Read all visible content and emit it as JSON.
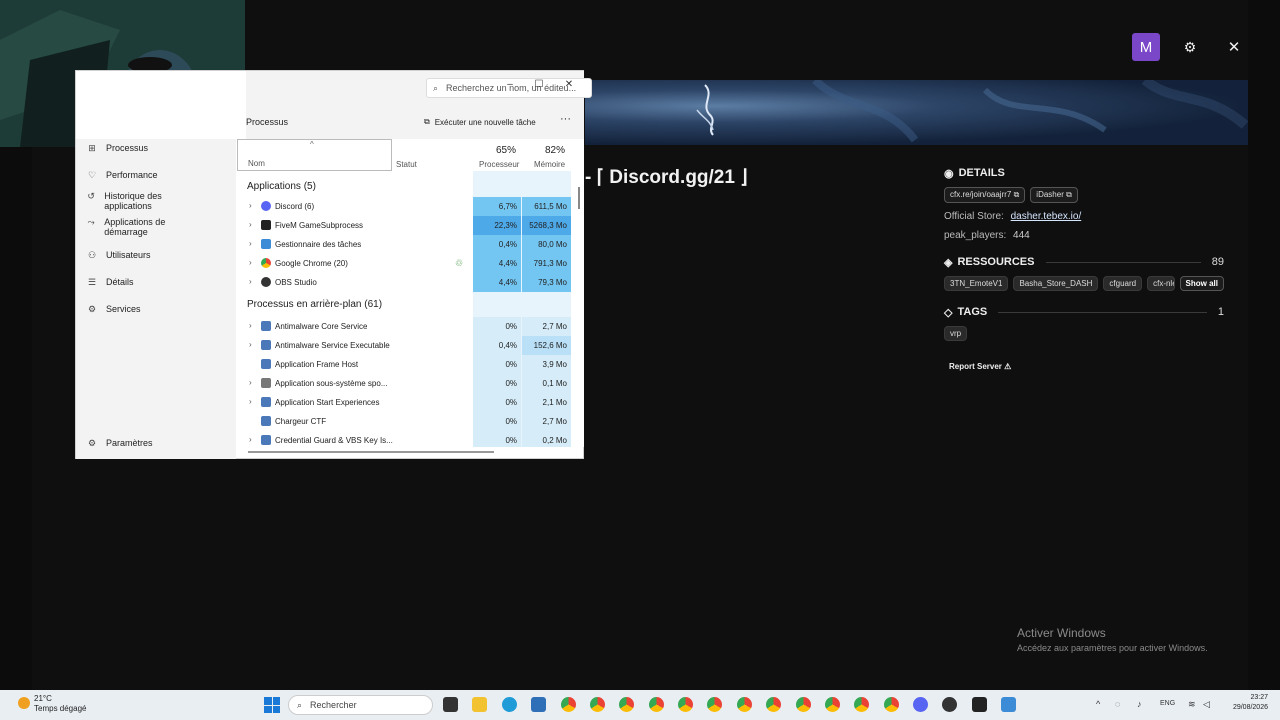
{
  "header": {
    "avatar_letter": "M",
    "settings_icon": "gear-icon",
    "close_icon": "close-icon"
  },
  "server": {
    "title_fragment": "- ⌈ Discord.gg/21 ⌋",
    "details": {
      "heading": "DETAILS",
      "links": [
        "cfx.re/join/oaajrr7 ⧉",
        "iDasher ⧉"
      ],
      "official_store_label": "Official Store:",
      "official_store_value": "dasher.tebex.io/",
      "peak_players_label": "peak_players:",
      "peak_players_value": "444"
    },
    "resources": {
      "heading": "RESSOURCES",
      "count": "89",
      "items": [
        "3TN_EmoteV1",
        "Basha_Store_DASH",
        "cfguard",
        "cfx-nle"
      ],
      "show_all": "Show all"
    },
    "tags": {
      "heading": "TAGS",
      "count": "1",
      "items": [
        "vrp"
      ]
    },
    "report": "Report Server ⚠"
  },
  "windows_activation": {
    "title": "Activer Windows",
    "subtitle": "Accédez aux paramètres pour activer Windows."
  },
  "task_manager": {
    "search_placeholder": "Recherchez un nom, un éditeu...",
    "window_controls": {
      "minimize": "–",
      "maximize": "☐",
      "close": "✕"
    },
    "page_title": "Processus",
    "run_task": "Exécuter une nouvelle tâche",
    "more": "···",
    "nav": {
      "processus": "Processus",
      "performance": "Performance",
      "historique": "Historique des applications",
      "demarrage": "Applications de démarrage",
      "utilisateurs": "Utilisateurs",
      "details": "Détails",
      "services": "Services",
      "parametres": "Paramètres"
    },
    "columns": {
      "nom": "Nom",
      "statut": "Statut",
      "processeur": "Processeur",
      "memoire": "Mémoire"
    },
    "totals": {
      "cpu": "65%",
      "mem": "82%"
    },
    "groups": {
      "apps": "Applications (5)",
      "background": "Processus en arrière-plan (61)"
    },
    "apps": [
      {
        "name": "Discord (6)",
        "cpu": "6,7%",
        "mem": "611,5 Mo"
      },
      {
        "name": "FiveM GameSubprocess",
        "cpu": "22,3%",
        "mem": "5268,3 Mo"
      },
      {
        "name": "Gestionnaire des tâches",
        "cpu": "0,4%",
        "mem": "80,0 Mo"
      },
      {
        "name": "Google Chrome (20)",
        "cpu": "4,4%",
        "mem": "791,3 Mo"
      },
      {
        "name": "OBS Studio",
        "cpu": "4,4%",
        "mem": "79,3 Mo"
      }
    ],
    "background": [
      {
        "name": "Antimalware Core Service",
        "cpu": "0%",
        "mem": "2,7 Mo"
      },
      {
        "name": "Antimalware Service Executable",
        "cpu": "0,4%",
        "mem": "152,6 Mo"
      },
      {
        "name": "Application Frame Host",
        "cpu": "0%",
        "mem": "3,9 Mo"
      },
      {
        "name": "Application sous-système spo...",
        "cpu": "0%",
        "mem": "0,1 Mo"
      },
      {
        "name": "Application Start Experiences",
        "cpu": "0%",
        "mem": "2,1 Mo"
      },
      {
        "name": "Chargeur CTF",
        "cpu": "0%",
        "mem": "2,7 Mo"
      },
      {
        "name": "Credential Guard & VBS Key Is...",
        "cpu": "0%",
        "mem": "0,2 Mo"
      }
    ]
  },
  "taskbar": {
    "weather_temp": "21°C",
    "weather_desc": "Temps dégagé",
    "search": "Rechercher",
    "lang": "ENG",
    "time": "23:27",
    "date": "29/08/2026"
  }
}
